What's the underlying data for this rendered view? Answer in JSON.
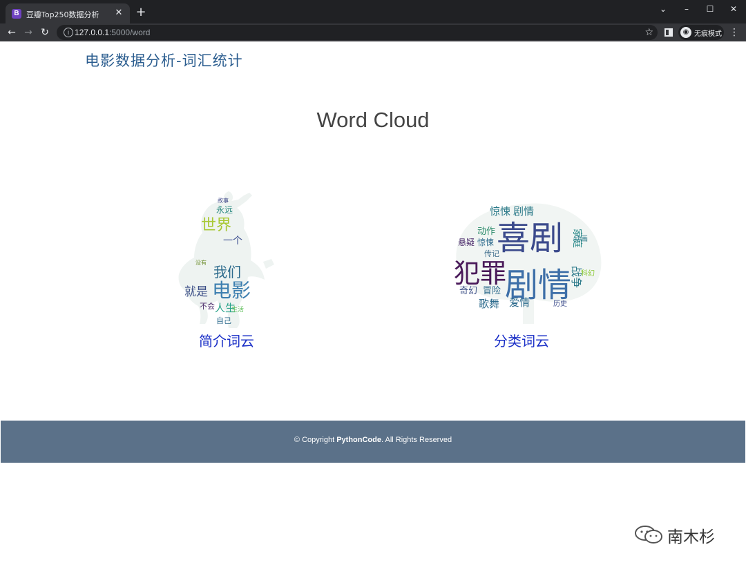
{
  "browser": {
    "tab_title": "豆瓣Top250数据分析",
    "tab_favicon_letter": "B",
    "new_tab_label": "+",
    "url_host": "127.0.0.1",
    "url_path": ":5000/word",
    "incognito_label": "无痕模式",
    "icons": [
      "back-arrow-icon",
      "forward-arrow-icon",
      "reload-icon",
      "info-icon",
      "bookmark-star-icon",
      "side-panel-icon",
      "incognito-icon",
      "kebab-menu-icon"
    ]
  },
  "header": {
    "brand": "电影数据分析-词汇统计"
  },
  "main": {
    "section_title": "Word Cloud",
    "clouds": [
      {
        "label": "简介词云",
        "words": [
          "故事",
          "永远",
          "世界",
          "我们",
          "就是",
          "电影",
          "人生",
          "不会",
          "自己",
          "生活",
          "没有",
          "一个"
        ]
      },
      {
        "label": "分类词云",
        "words": [
          "惊悚",
          "剧情",
          "喜剧",
          "动作",
          "悬疑",
          "惊悚",
          "家庭",
          "动画",
          "传记",
          "犯罪",
          "剧情",
          "爱情",
          "科幻",
          "奇幻",
          "冒险",
          "战争",
          "歌舞",
          "历史"
        ]
      }
    ]
  },
  "footer": {
    "copyright_prefix": "© Copyright ",
    "brand": "PythonCode",
    "suffix": ". All Rights Reserved"
  },
  "watermark": {
    "text": "南木杉"
  }
}
